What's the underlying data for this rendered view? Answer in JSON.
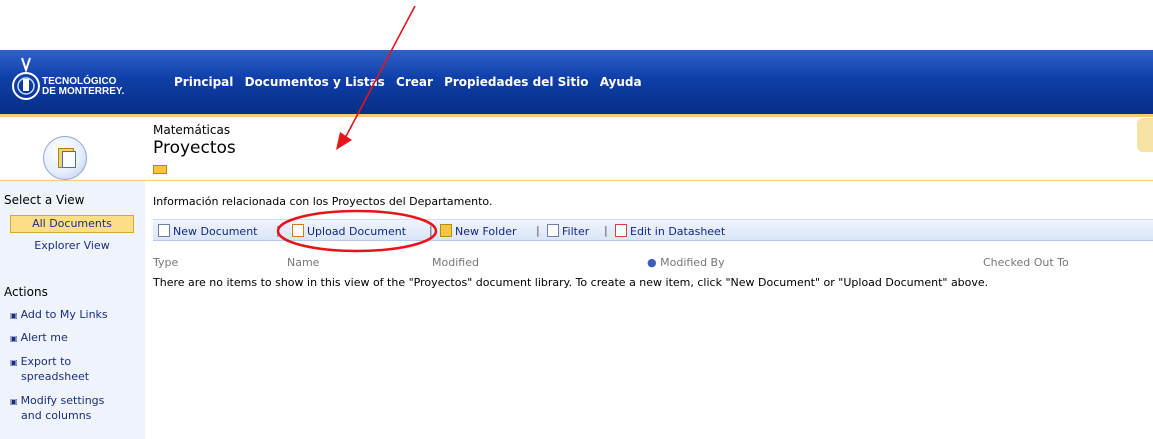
{
  "branding": {
    "line1": "TECNOLÓGICO",
    "line2": "DE MONTERREY."
  },
  "nav": {
    "items": [
      "Principal",
      "Documentos y Listas",
      "Crear",
      "Propiedades del Sitio",
      "Ayuda"
    ]
  },
  "header": {
    "site_name": "Matemáticas",
    "list_name": "Proyectos"
  },
  "sidebar": {
    "select_view_heading": "Select a View",
    "views": [
      "All Documents",
      "Explorer View"
    ],
    "actions_heading": "Actions",
    "actions": [
      {
        "line1": "Add to My Links",
        "line2": ""
      },
      {
        "line1": "Alert me",
        "line2": ""
      },
      {
        "line1": "Export to",
        "line2": "spreadsheet"
      },
      {
        "line1": "Modify settings",
        "line2": "and columns"
      }
    ]
  },
  "main": {
    "description": "Información relacionada con los Proyectos del Departamento.",
    "toolbar": {
      "new_document": "New Document",
      "upload_document": "Upload Document",
      "new_folder": "New Folder",
      "filter": "Filter",
      "edit_datasheet": "Edit in Datasheet",
      "separator": "|"
    },
    "columns": {
      "type": "Type",
      "name": "Name",
      "modified": "Modified",
      "modified_by": "Modified By",
      "checked_out_to": "Checked Out To"
    },
    "empty_message": "There are no items to show in this view of the \"Proyectos\" document library. To create a new item, click \"New Document\" or \"Upload Document\" above."
  },
  "colors": {
    "banner": "#0e3fa8",
    "accent": "#f5cd6d",
    "annotation": "#e8141b",
    "link": "#12278a"
  },
  "icons": [
    "logo-crest-icon",
    "document-library-icon",
    "folder-icon",
    "new-document-icon",
    "upload-icon",
    "new-folder-icon",
    "filter-icon",
    "datasheet-icon",
    "person-icon",
    "search-icon"
  ]
}
